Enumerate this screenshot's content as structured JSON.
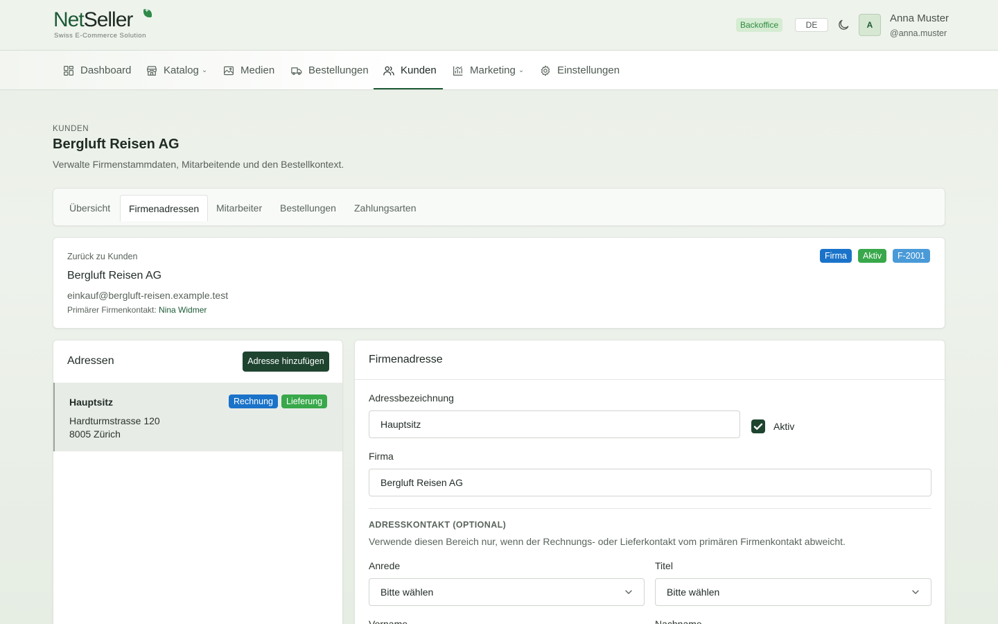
{
  "brand": {
    "name_part1": "Net",
    "name_part2": "Seller",
    "tagline": "Swiss E-Commerce Solution"
  },
  "header": {
    "badge": "Backoffice",
    "language": "DE",
    "theme_icon": "moon-icon",
    "user": {
      "initial": "A",
      "name": "Anna Muster",
      "handle": "@anna.muster"
    }
  },
  "nav": {
    "items": [
      {
        "label": "Dashboard",
        "icon": "dashboard-icon"
      },
      {
        "label": "Katalog",
        "icon": "store-icon",
        "has_dropdown": true
      },
      {
        "label": "Medien",
        "icon": "image-icon"
      },
      {
        "label": "Bestellungen",
        "icon": "truck-icon"
      },
      {
        "label": "Kunden",
        "icon": "users-icon",
        "active": true
      },
      {
        "label": "Marketing",
        "icon": "chart-icon",
        "has_dropdown": true
      },
      {
        "label": "Einstellungen",
        "icon": "gear-icon"
      }
    ]
  },
  "page": {
    "eyebrow": "KUNDEN",
    "title": "Bergluft Reisen AG",
    "subtitle": "Verwalte Firmenstammdaten, Mitarbeitende und den Bestellkontext."
  },
  "tabs": [
    {
      "label": "Übersicht"
    },
    {
      "label": "Firmenadressen",
      "active": true
    },
    {
      "label": "Mitarbeiter"
    },
    {
      "label": "Bestellungen"
    },
    {
      "label": "Zahlungsarten"
    }
  ],
  "customer": {
    "back_label": "Zurück zu Kunden",
    "name": "Bergluft Reisen AG",
    "email": "einkauf@bergluft-reisen.example.test",
    "contact_label": "Primärer Firmenkontakt:",
    "contact_name": "Nina Widmer",
    "badges": [
      "Firma",
      "Aktiv",
      "F-2001"
    ]
  },
  "addresses": {
    "title": "Adressen",
    "add_button": "Adresse hinzufügen",
    "items": [
      {
        "name": "Hauptsitz",
        "line1": "Hardturmstrasse 120",
        "line2": "8005 Zürich",
        "tags": [
          "Rechnung",
          "Lieferung"
        ]
      }
    ]
  },
  "form": {
    "title": "Firmenadresse",
    "label_field": {
      "label": "Adressbezeichnung",
      "value": "Hauptsitz"
    },
    "active": {
      "label": "Aktiv",
      "checked": true
    },
    "company": {
      "label": "Firma",
      "value": "Bergluft Reisen AG"
    },
    "contact_section": {
      "heading": "ADRESSKONTAKT (OPTIONAL)",
      "description": "Verwende diesen Bereich nur, wenn der Rechnungs- oder Lieferkontakt vom primären Firmenkontakt abweicht."
    },
    "salutation": {
      "label": "Anrede",
      "value": "Bitte wählen"
    },
    "title_field": {
      "label": "Titel",
      "value": "Bitte wählen"
    },
    "first_name": {
      "label": "Vorname"
    },
    "last_name": {
      "label": "Nachname"
    }
  },
  "colors": {
    "brand_green": "#1c5a36",
    "dark_button": "#1e4430",
    "badge_blue": "#1a73c9",
    "badge_green": "#38a84a",
    "badge_light_blue": "#4a9ad8"
  }
}
